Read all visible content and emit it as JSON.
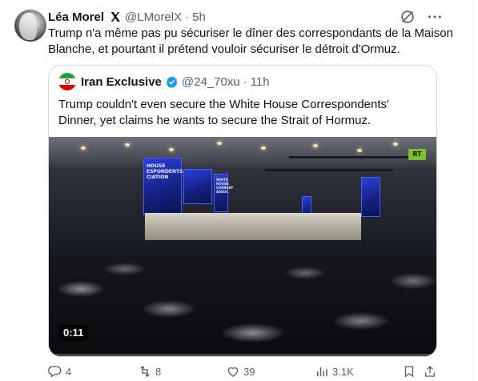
{
  "tweet": {
    "author_name": "Léa Morel",
    "handle": "@LMorelX",
    "separator": "·",
    "time": "5h",
    "text": "Trump n'a même pas pu sécuriser le dîner des correspondants de la Maison Blanche, et pourtant il prétend vouloir sécuriser le détroit d'Ormuz."
  },
  "quote": {
    "author_name": "Iran Exclusive",
    "handle": "@24_70xu",
    "separator": "·",
    "time": "11h",
    "text": "Trump couldn't even secure the White House Correspondents' Dinner, yet claims he wants to secure the Strait of Hormuz.",
    "video": {
      "duration": "0:11",
      "progress": 0.0,
      "channel_logo": "RT",
      "screen_text_left": "HOUSE\nESPONDENTS'\nCIATION",
      "screen_text_right": "WHITE\nHOUSE\nCORRESP\nASSOC"
    }
  },
  "actions": {
    "reply_count": "4",
    "repost_count": "8",
    "like_count": "39",
    "views_count": "3.1K"
  },
  "icons": [
    "x-premium-icon",
    "grok-icon",
    "more-icon",
    "verified-icon",
    "reply-icon",
    "repost-icon",
    "like-icon",
    "views-icon",
    "bookmark-icon",
    "share-icon"
  ],
  "colors": {
    "text_primary": "#0f1419",
    "text_secondary": "#536471",
    "verified_blue": "#1d9bf0",
    "border": "#cfd9de"
  }
}
